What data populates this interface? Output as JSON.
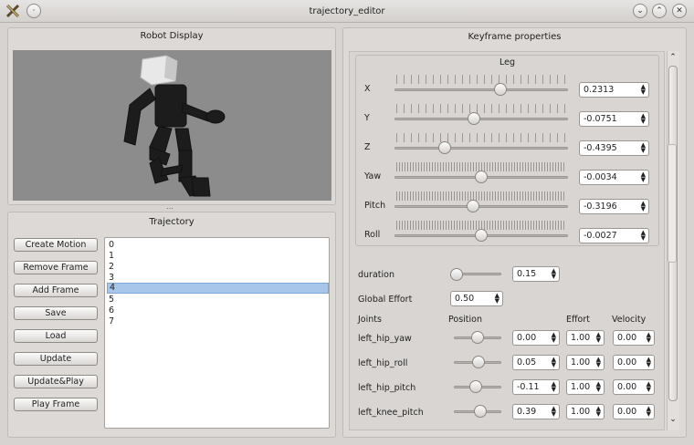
{
  "window": {
    "title": "trajectory_editor"
  },
  "robot_display": {
    "title": "Robot Display"
  },
  "trajectory": {
    "title": "Trajectory",
    "buttons": [
      "Create Motion",
      "Remove Frame",
      "Add Frame",
      "Save",
      "Load",
      "Update",
      "Update&Play",
      "Play Frame"
    ],
    "frames": [
      "0",
      "1",
      "2",
      "3",
      "4",
      "5",
      "6",
      "7"
    ],
    "selected": 4
  },
  "keyframe": {
    "title": "Keyframe properties",
    "leg_title": "Leg",
    "leg": [
      {
        "label": "X",
        "value": "0.2313",
        "level": 0.61
      },
      {
        "label": "Y",
        "value": "-0.0751",
        "level": 0.46
      },
      {
        "label": "Z",
        "value": "-0.4395",
        "level": 0.29
      },
      {
        "label": "Yaw",
        "value": "-0.0034",
        "level": 0.5
      },
      {
        "label": "Pitch",
        "value": "-0.3196",
        "level": 0.45
      },
      {
        "label": "Roll",
        "value": "-0.0027",
        "level": 0.5
      }
    ],
    "duration": {
      "label": "duration",
      "value": "0.15",
      "level": 0.1
    },
    "global_effort": {
      "label": "Global Effort",
      "value": "0.50"
    },
    "headers": {
      "joints": "Joints",
      "position": "Position",
      "effort": "Effort",
      "velocity": "Velocity"
    },
    "joints": [
      {
        "name": "left_hip_yaw",
        "position": "0.00",
        "effort": "1.00",
        "velocity": "0.00",
        "level": 0.5
      },
      {
        "name": "left_hip_roll",
        "position": "0.05",
        "effort": "1.00",
        "velocity": "0.00",
        "level": 0.52
      },
      {
        "name": "left_hip_pitch",
        "position": "-0.11",
        "effort": "1.00",
        "velocity": "0.00",
        "level": 0.47
      },
      {
        "name": "left_knee_pitch",
        "position": "0.39",
        "effort": "1.00",
        "velocity": "0.00",
        "level": 0.55
      }
    ]
  },
  "colors": {
    "selection": "#a7c6ea",
    "viewport": "#8c8c8c"
  }
}
